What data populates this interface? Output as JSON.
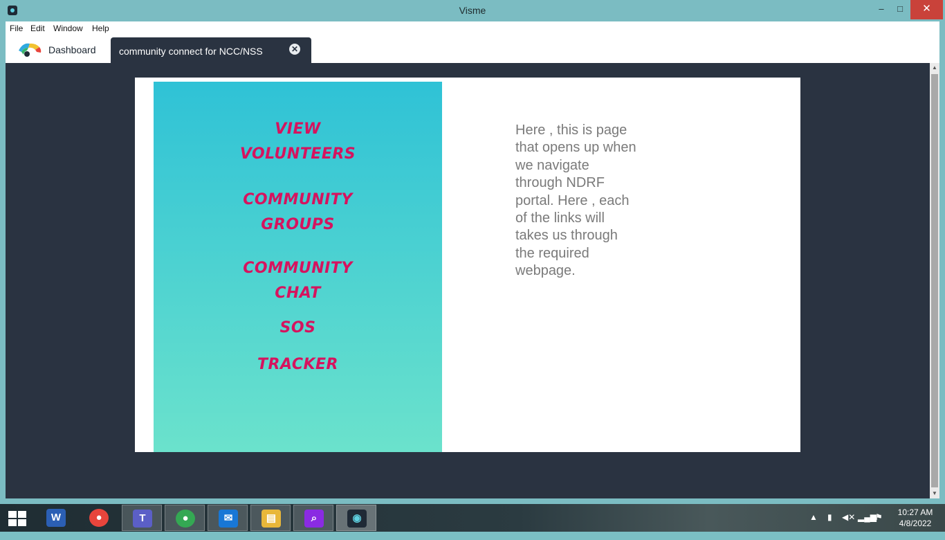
{
  "window": {
    "title": "Visme",
    "minimize_glyph": "–",
    "maximize_glyph": "□",
    "close_glyph": "✕"
  },
  "menu": {
    "items": [
      {
        "label": "File"
      },
      {
        "label": "Edit"
      },
      {
        "label": "Window"
      },
      {
        "label": "Help"
      }
    ]
  },
  "tabs": {
    "dashboard_label": "Dashboard",
    "active_label": "community connect for NCC/NSS",
    "close_glyph": "✕"
  },
  "canvas": {
    "links": [
      {
        "label": "VIEW\nVOLUNTEERS"
      },
      {
        "label": "COMMUNITY\nGROUPS"
      },
      {
        "label": "COMMUNITY\nCHAT"
      },
      {
        "label": "SOS"
      },
      {
        "label": "TRACKER"
      }
    ],
    "description": "Here , this is page that opens up when we navigate through NDRF portal. Here , each of the links will takes us through the required webpage.",
    "link_color": "#d6135e",
    "panel_gradient": [
      "#2fc2d6",
      "#6be2cc"
    ]
  },
  "taskbar": {
    "apps": [
      {
        "name": "word-icon",
        "glyph": "W",
        "color": "#2b5fb4"
      },
      {
        "name": "chrome-icon",
        "glyph": "●",
        "color": "#e8453c"
      },
      {
        "name": "teams-icon",
        "glyph": "T",
        "color": "#5b5fc7"
      },
      {
        "name": "chrome-profile-icon",
        "glyph": "●",
        "color": "#34a853"
      },
      {
        "name": "mail-icon",
        "glyph": "✉",
        "color": "#1877d6"
      },
      {
        "name": "file-explorer-icon",
        "glyph": "▤",
        "color": "#e8b73a"
      },
      {
        "name": "search-app-icon",
        "glyph": "⌕",
        "color": "#8a2be2"
      },
      {
        "name": "visme-icon",
        "glyph": "◉",
        "color": "#1f2a36"
      }
    ],
    "clock_time": "10:27 AM",
    "clock_date": "4/8/2022"
  }
}
